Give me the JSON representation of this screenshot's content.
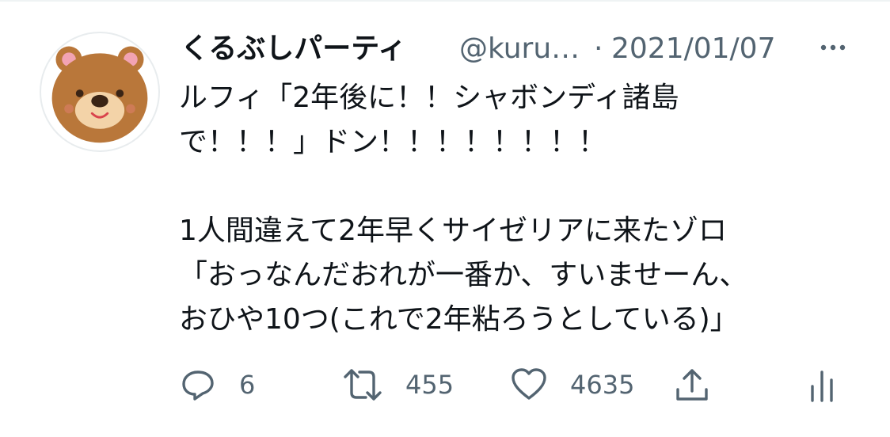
{
  "tweet": {
    "display_name": "くるぶしパーティ",
    "handle": "@kuru…",
    "separator": "·",
    "timestamp": "2021/01/07",
    "text": "ルフィ「2年後に！！シャボンディ諸島\nで！！！」ドン！！！！！！！！\n\n1人間違えて2年早くサイゼリアに来たゾロ\n「おっなんだおれが一番か、すいませーん、\nおひや10つ(これで2年粘ろうとしている)」",
    "avatar_icon": "bear-avatar",
    "more_icon": "more-dots-icon"
  },
  "actions": {
    "reply": {
      "icon": "reply-icon",
      "count": "6"
    },
    "retweet": {
      "icon": "retweet-icon",
      "count": "455"
    },
    "like": {
      "icon": "heart-icon",
      "count": "4635"
    },
    "share": {
      "icon": "share-icon"
    },
    "analytics": {
      "icon": "analytics-icon"
    }
  },
  "colors": {
    "text_primary": "#0f1419",
    "text_secondary": "#536471",
    "bear_brown": "#b9773a",
    "bear_muzzle": "#f3d3a8",
    "bear_ear_inner": "#f2a3b3"
  }
}
